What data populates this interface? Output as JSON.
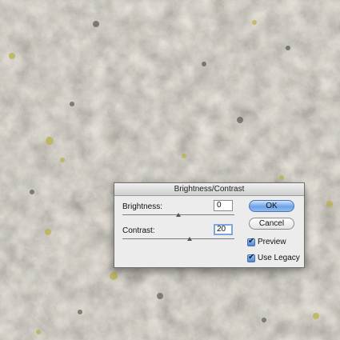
{
  "dialog": {
    "title": "Brightness/Contrast",
    "brightness": {
      "label": "Brightness:",
      "value": "0",
      "slider_fraction": 0.5
    },
    "contrast": {
      "label": "Contrast:",
      "value": "20",
      "slider_fraction": 0.6
    },
    "ok_label": "OK",
    "cancel_label": "Cancel",
    "preview": {
      "label": "Preview",
      "checked": true
    },
    "use_legacy": {
      "label": "Use Legacy",
      "checked": true
    }
  },
  "icons": {
    "checkbox_mark": "checkmark-icon",
    "slider_thumb": "triangle-thumb-icon"
  },
  "colors": {
    "ok_button": "#6fa2e6",
    "background_stone": "#8d8880",
    "lichen": "#b8b24a"
  }
}
